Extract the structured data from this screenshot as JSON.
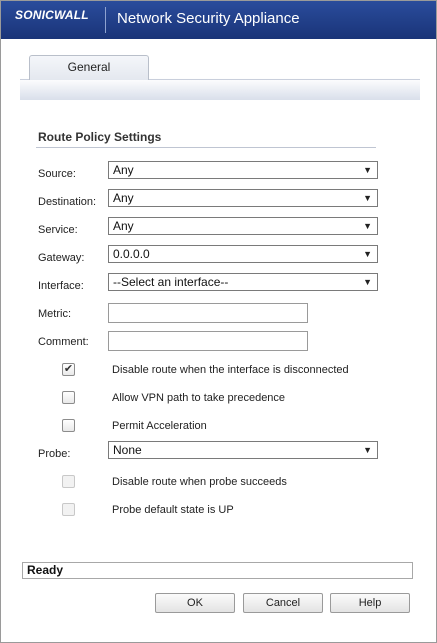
{
  "header": {
    "logo": "SONICWALL",
    "title": "Network Security Appliance"
  },
  "tabs": [
    {
      "label": "General"
    }
  ],
  "section": {
    "title": "Route Policy Settings"
  },
  "fields": {
    "source": {
      "label": "Source:",
      "value": "Any"
    },
    "destination": {
      "label": "Destination:",
      "value": "Any"
    },
    "service": {
      "label": "Service:",
      "value": "Any"
    },
    "gateway": {
      "label": "Gateway:",
      "value": "0.0.0.0"
    },
    "interface": {
      "label": "Interface:",
      "value": "--Select an interface--"
    },
    "metric": {
      "label": "Metric:",
      "value": ""
    },
    "comment": {
      "label": "Comment:",
      "value": ""
    },
    "probe": {
      "label": "Probe:",
      "value": "None"
    }
  },
  "checkboxes": {
    "disable_route": {
      "label": "Disable route when the interface is disconnected",
      "checked": true,
      "enabled": true
    },
    "allow_vpn": {
      "label": "Allow VPN path to take precedence",
      "checked": false,
      "enabled": true
    },
    "permit_accel": {
      "label": "Permit Acceleration",
      "checked": false,
      "enabled": true
    },
    "disable_probe": {
      "label": "Disable route when probe succeeds",
      "checked": false,
      "enabled": false
    },
    "probe_default": {
      "label": "Probe default state is UP",
      "checked": false,
      "enabled": false
    }
  },
  "status": {
    "text": "Ready"
  },
  "buttons": {
    "ok": "OK",
    "cancel": "Cancel",
    "help": "Help"
  }
}
